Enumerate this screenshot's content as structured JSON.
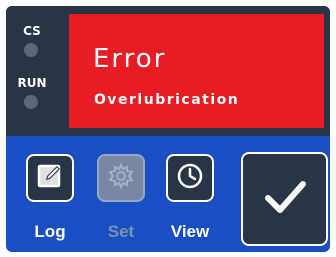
{
  "indicators": {
    "cs_label": "CS",
    "run_label": "RUN"
  },
  "error": {
    "title": "Error",
    "message": "Overlubrication"
  },
  "toolbar": {
    "log_label": "Log",
    "set_label": "Set",
    "view_label": "View"
  },
  "icons": {
    "log": "edit-icon",
    "set": "gear-icon",
    "view": "clock-icon",
    "confirm": "checkmark-icon"
  },
  "colors": {
    "error_background": "#e81c23",
    "panel_background": "#2a3447",
    "button_bar_background": "#1a4fc4",
    "led_off": "#5e6778",
    "disabled": "#7887a3"
  }
}
